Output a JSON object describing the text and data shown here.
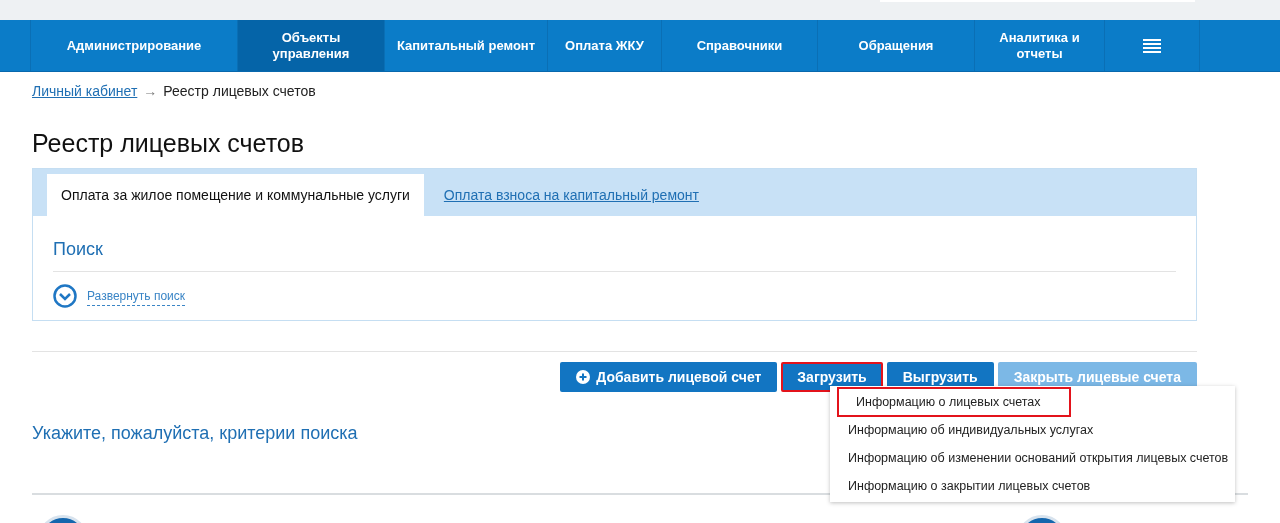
{
  "nav": {
    "items": [
      {
        "label": "Администрирование",
        "selected": false
      },
      {
        "label": "Объекты управления",
        "selected": true
      },
      {
        "label": "Капитальный ремонт",
        "selected": false
      },
      {
        "label": "Оплата ЖКУ",
        "selected": false
      },
      {
        "label": "Справочники",
        "selected": false
      },
      {
        "label": "Обращения",
        "selected": false
      },
      {
        "label": "Аналитика и отчеты",
        "selected": false
      }
    ]
  },
  "breadcrumb": {
    "link": "Личный кабинет",
    "separator": "→",
    "current": "Реестр лицевых счетов"
  },
  "title": "Реестр лицевых счетов",
  "tabs": [
    {
      "label": "Оплата за жилое помещение и коммунальные услуги",
      "selected": true
    },
    {
      "label": "Оплата взноса на капитальный ремонт",
      "selected": false
    }
  ],
  "search": {
    "title": "Поиск",
    "expand_link": "Развернуть поиск"
  },
  "buttons": [
    {
      "kind": "icon",
      "label": "Добавить лицевой счет",
      "disabled": false,
      "highlighted": false
    },
    {
      "kind": "plain",
      "label": "Загрузить",
      "disabled": false,
      "highlighted": true
    },
    {
      "kind": "plain",
      "label": "Выгрузить",
      "disabled": false,
      "highlighted": false
    },
    {
      "kind": "plain",
      "label": "Закрыть лицевые счета",
      "disabled": true,
      "highlighted": false
    }
  ],
  "dropdown": [
    {
      "label": "Информацию о лицевых счетах",
      "highlighted": true
    },
    {
      "label": "Информацию об индивидуальных услугах",
      "highlighted": false
    },
    {
      "label": "Информацию об изменении оснований открытия лицевых счетов",
      "highlighted": false
    },
    {
      "label": "Информацию о закрытии лицевых счетов",
      "highlighted": false
    }
  ],
  "message": "Укажите, пожалуйста, критерии поиска"
}
